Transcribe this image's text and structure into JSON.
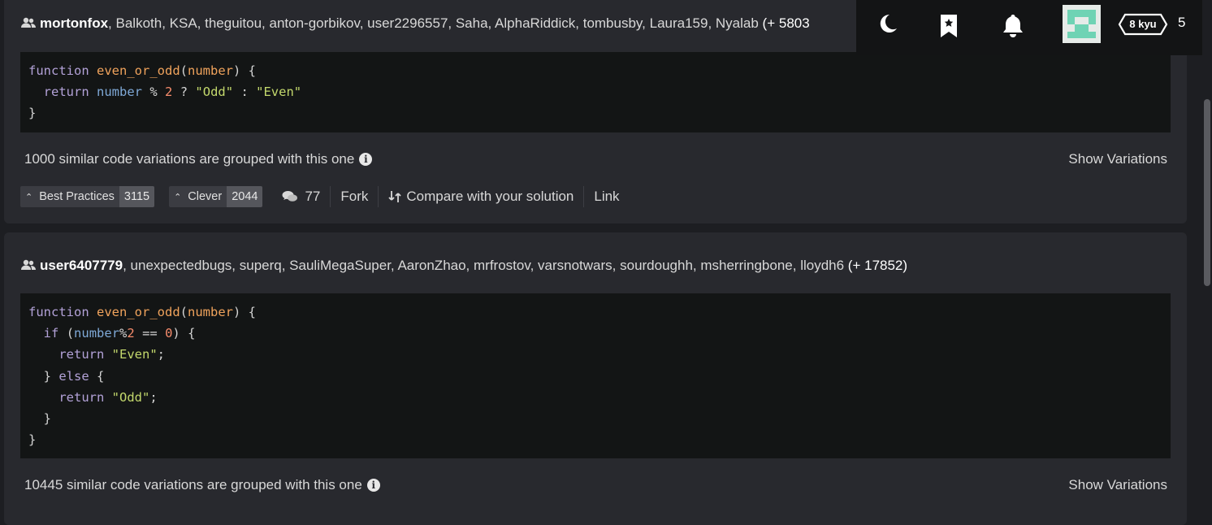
{
  "solutions": [
    {
      "authors_lead": "mortonfox",
      "authors_rest": ", Balkoth, KSA, theguitou, anton-gorbikov, user2296557, Saha, AlphaRiddick, tombusby, Laura159, Nyalab ",
      "authors_more": "(+ 5803",
      "variations_text": "1000 similar code variations are grouped with this one",
      "show_variations": "Show Variations",
      "best_practices_label": "Best Practices",
      "best_practices_count": "3115",
      "clever_label": "Clever",
      "clever_count": "2044",
      "comments_count": "77",
      "fork_label": "Fork",
      "compare_label": "Compare with your solution",
      "link_label": "Link"
    },
    {
      "authors_lead": "user6407779",
      "authors_rest": ", unexpectedbugs, superq, SauliMegaSuper, AaronZhao, mrfrostov, varsnotwars, sourdoughh, msherringbone, lloydh6 ",
      "authors_more": "(+ 17852)",
      "variations_text": "10445 similar code variations are grouped with this one",
      "show_variations": "Show Variations"
    }
  ],
  "topbar": {
    "rank": "8 kyu",
    "honor": "5"
  },
  "icons": [
    "users-icon",
    "info-icon",
    "chevron-up-icon",
    "comments-icon",
    "compare-icon",
    "moon-icon",
    "bookmark-icon",
    "bell-icon"
  ]
}
